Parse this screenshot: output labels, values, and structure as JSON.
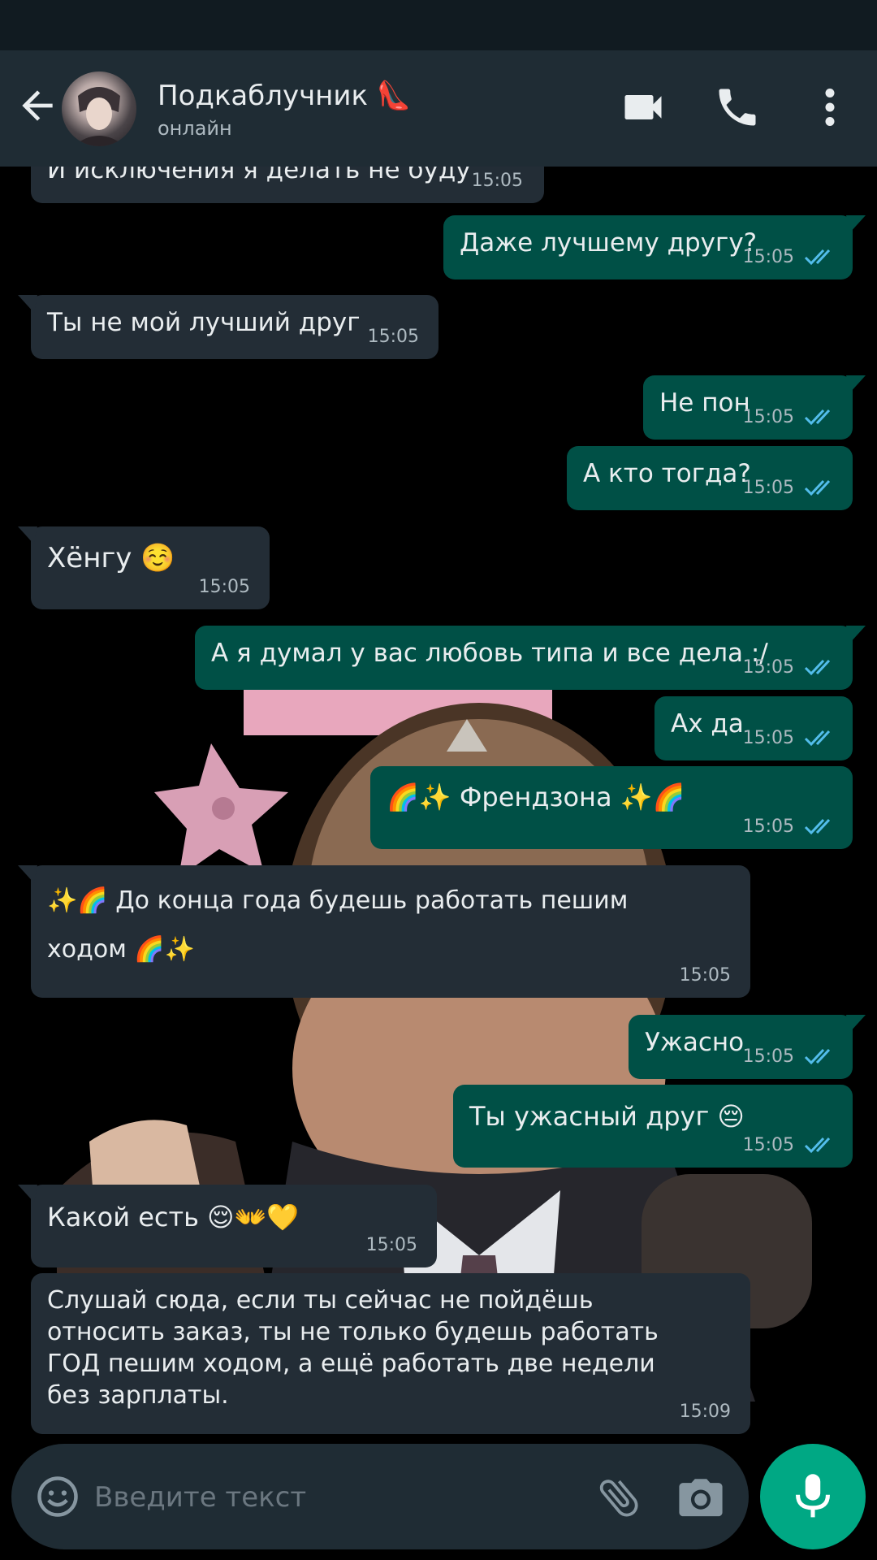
{
  "contact": {
    "name": "Подкаблучник 👠",
    "status": "онлайн"
  },
  "colors": {
    "accent": "#00a884",
    "outgoing_bubble": "#005046",
    "incoming_bubble": "#232d36",
    "read_ticks": "#53bdeb"
  },
  "messages": [
    {
      "dir": "in",
      "text": "И исключения я делать не буду",
      "time": "15:05"
    },
    {
      "dir": "out",
      "text": "Даже лучшему другу?",
      "time": "15:05",
      "read": true
    },
    {
      "dir": "in",
      "text": "Ты не мой лучший друг",
      "time": "15:05"
    },
    {
      "dir": "out",
      "text": "Не пон",
      "time": "15:05",
      "read": true
    },
    {
      "dir": "out",
      "text": "А кто тогда?",
      "time": "15:05",
      "read": true
    },
    {
      "dir": "in",
      "text": "Хёнгу ☺️",
      "time": "15:05"
    },
    {
      "dir": "out",
      "text": "А я думал у вас любовь типа и все дела :/",
      "time": "15:05",
      "read": true
    },
    {
      "dir": "out",
      "text": "Ах да",
      "time": "15:05",
      "read": true
    },
    {
      "dir": "out",
      "text": "🌈✨ Френдзона ✨🌈",
      "time": "15:05",
      "read": true
    },
    {
      "dir": "in",
      "text": "✨🌈 До конца года будешь работать пешим ходом 🌈✨",
      "time": "15:05"
    },
    {
      "dir": "out",
      "text": "Ужасно",
      "time": "15:05",
      "read": true
    },
    {
      "dir": "out",
      "text": "Ты ужасный друг 😔",
      "time": "15:05",
      "read": true
    },
    {
      "dir": "in",
      "text": "Какой есть 😌👐💛",
      "time": "15:05"
    },
    {
      "dir": "in",
      "text": "Слушай сюда, если ты сейчас не пойдёшь относить заказ, ты не только будешь работать ГОД пешим ходом, а ещё работать две недели без зарплаты.",
      "time": "15:09"
    }
  ],
  "composer": {
    "placeholder": "Введите текст"
  },
  "icons": {
    "back": "arrow-left-icon",
    "video": "video-camera-icon",
    "call": "phone-icon",
    "menu": "more-vert-icon",
    "emoji": "smiley-icon",
    "attach": "paperclip-icon",
    "camera": "camera-icon",
    "mic": "microphone-icon",
    "read": "double-check-icon"
  }
}
